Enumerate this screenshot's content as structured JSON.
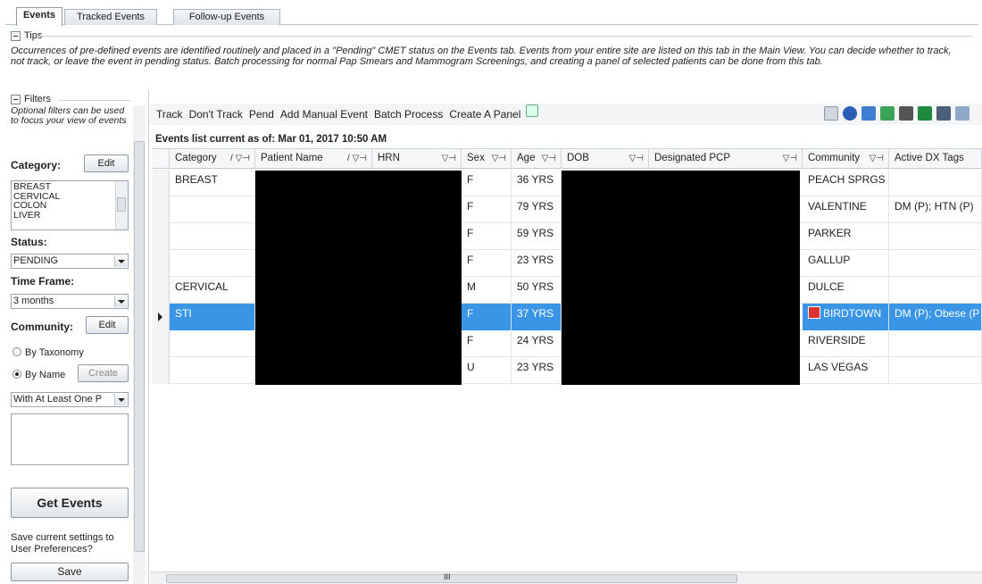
{
  "tabs": [
    "Events",
    "Tracked Events",
    "Follow-up Events"
  ],
  "tips": {
    "title": "Tips",
    "text": "Occurrences of pre-defined events are identified routinely and placed in a \"Pending\" CMET status on the Events tab.  Events from your entire site are listed on this tab in the Main View.  You can decide whether to track, not track, or leave the event in pending status. Batch processing for normal Pap Smears and Mammogram Screenings, and creating a panel of selected patients can be done from this tab."
  },
  "filters": {
    "title": "Filters",
    "help_text": "Optional filters can be used to focus your view of events",
    "category_label": "Category:",
    "category_edit": "Edit",
    "categories": [
      "BREAST",
      "CERVICAL",
      "COLON",
      "LIVER"
    ],
    "status_label": "Status:",
    "status_value": "PENDING",
    "timeframe_label": "Time Frame:",
    "timeframe_value": "3 months",
    "community_label": "Community:",
    "community_edit": "Edit",
    "by_taxonomy": "By Taxonomy",
    "by_name": "By Name",
    "create_label": "Create",
    "panel_filter_value": "With At Least One P",
    "get_events": "Get Events",
    "save_prompt": "Save current settings to User Preferences?",
    "save": "Save"
  },
  "toolbar": {
    "items": [
      "Track",
      "Don't Track",
      "Pend",
      "Add Manual Event",
      "Batch Process",
      "Create A Panel"
    ],
    "icons": [
      "window-icon",
      "help-icon",
      "undo-icon",
      "refresh-icon",
      "binoculars-icon",
      "excel-icon",
      "print-icon",
      "copy-icon"
    ]
  },
  "list_current": "Events list current as of: Mar 01, 2017 10:50 AM",
  "grid": {
    "columns": [
      "Category",
      "Patient Name",
      "HRN",
      "Sex",
      "Age",
      "DOB",
      "Designated PCP",
      "Community",
      "Active DX Tags"
    ],
    "rows": [
      {
        "category": "BREAST",
        "sex": "F",
        "age": "36 YRS",
        "community": "PEACH SPRGS",
        "tags": ""
      },
      {
        "category": "",
        "sex": "F",
        "age": "79 YRS",
        "community": "VALENTINE",
        "tags": "DM (P); HTN (P)"
      },
      {
        "category": "",
        "sex": "F",
        "age": "59 YRS",
        "community": "PARKER",
        "tags": ""
      },
      {
        "category": "",
        "sex": "F",
        "age": "23 YRS",
        "community": "GALLUP",
        "tags": ""
      },
      {
        "category": "CERVICAL",
        "sex": "M",
        "age": "50 YRS",
        "community": "DULCE",
        "tags": ""
      },
      {
        "category": "STI",
        "sex": "F",
        "age": "37 YRS",
        "community": "BIRDTOWN",
        "tags": "DM (P); Obese (P"
      },
      {
        "category": "",
        "sex": "F",
        "age": "24 YRS",
        "community": "RIVERSIDE",
        "tags": ""
      },
      {
        "category": "",
        "sex": "U",
        "age": "23 YRS",
        "community": "LAS VEGAS",
        "tags": ""
      }
    ]
  },
  "hscroll_label": "III"
}
